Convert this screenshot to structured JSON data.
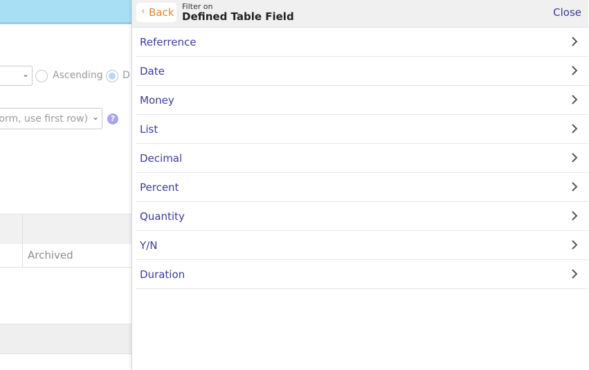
{
  "background": {
    "sort": {
      "ascending_label": "Ascending",
      "descending_label_partial": "D"
    },
    "row_select_text": "form, use first row)",
    "help_glyph": "?",
    "table_cell": "Archived"
  },
  "panel": {
    "back_label": "Back",
    "subtitle": "Filter on",
    "title": "Defined Table Field",
    "close_label": "Close",
    "items": [
      {
        "label": "Referrence"
      },
      {
        "label": "Date"
      },
      {
        "label": "Money"
      },
      {
        "label": "List"
      },
      {
        "label": "Decimal"
      },
      {
        "label": "Percent"
      },
      {
        "label": "Quantity"
      },
      {
        "label": "Y/N"
      },
      {
        "label": "Duration"
      }
    ]
  },
  "colors": {
    "accent_text": "#3a3a9e",
    "back_text": "#e2862a",
    "top_bar": "#a8dff5"
  }
}
